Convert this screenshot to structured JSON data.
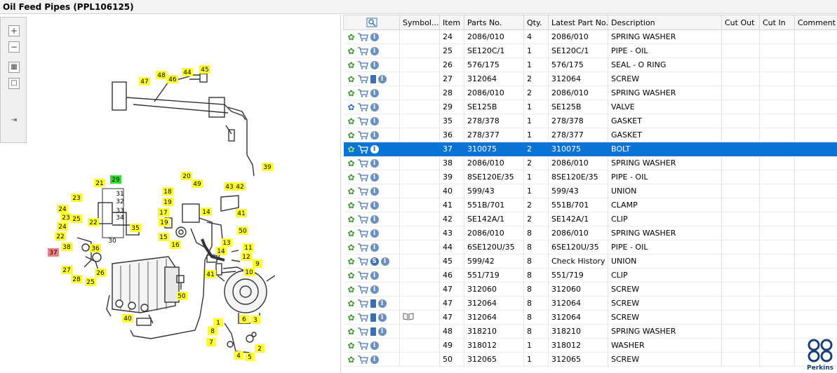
{
  "window": {
    "title": "Oil Feed Pipes (PPL106125)"
  },
  "toolbar": {
    "zoom_in": "+",
    "zoom_out": "−",
    "fit": "▦",
    "actual": "□",
    "export": "⇥"
  },
  "diagram": {
    "callouts": [
      {
        "label": "47",
        "style": "yellow"
      },
      {
        "label": "48",
        "style": "yellow"
      },
      {
        "label": "46",
        "style": "yellow"
      },
      {
        "label": "44",
        "style": "yellow"
      },
      {
        "label": "45",
        "style": "yellow"
      },
      {
        "label": "39",
        "style": "yellow"
      },
      {
        "label": "29",
        "style": "green"
      },
      {
        "label": "21",
        "style": "yellow"
      },
      {
        "label": "31",
        "style": "plain"
      },
      {
        "label": "32",
        "style": "plain"
      },
      {
        "label": "33",
        "style": "plain"
      },
      {
        "label": "34",
        "style": "plain"
      },
      {
        "label": "30",
        "style": "plain"
      },
      {
        "label": "35",
        "style": "yellow"
      },
      {
        "label": "23",
        "style": "yellow"
      },
      {
        "label": "24",
        "style": "yellow"
      },
      {
        "label": "25",
        "style": "yellow"
      },
      {
        "label": "23",
        "style": "yellow"
      },
      {
        "label": "24",
        "style": "yellow"
      },
      {
        "label": "22",
        "style": "yellow"
      },
      {
        "label": "22",
        "style": "yellow"
      },
      {
        "label": "38",
        "style": "yellow"
      },
      {
        "label": "36",
        "style": "yellow"
      },
      {
        "label": "37",
        "style": "red"
      },
      {
        "label": "27",
        "style": "yellow"
      },
      {
        "label": "28",
        "style": "yellow"
      },
      {
        "label": "25",
        "style": "yellow"
      },
      {
        "label": "26",
        "style": "yellow"
      },
      {
        "label": "20",
        "style": "yellow"
      },
      {
        "label": "49",
        "style": "yellow"
      },
      {
        "label": "18",
        "style": "yellow"
      },
      {
        "label": "19",
        "style": "yellow"
      },
      {
        "label": "17",
        "style": "yellow"
      },
      {
        "label": "19",
        "style": "yellow"
      },
      {
        "label": "14",
        "style": "yellow"
      },
      {
        "label": "15",
        "style": "yellow"
      },
      {
        "label": "16",
        "style": "yellow"
      },
      {
        "label": "43",
        "style": "yellow"
      },
      {
        "label": "42",
        "style": "yellow"
      },
      {
        "label": "41",
        "style": "yellow"
      },
      {
        "label": "50",
        "style": "yellow"
      },
      {
        "label": "13",
        "style": "yellow"
      },
      {
        "label": "14",
        "style": "yellow"
      },
      {
        "label": "11",
        "style": "yellow"
      },
      {
        "label": "12",
        "style": "yellow"
      },
      {
        "label": "9",
        "style": "yellow"
      },
      {
        "label": "10",
        "style": "yellow"
      },
      {
        "label": "41",
        "style": "yellow"
      },
      {
        "label": "50",
        "style": "yellow"
      },
      {
        "label": "40",
        "style": "yellow"
      },
      {
        "label": "1",
        "style": "yellow"
      },
      {
        "label": "6",
        "style": "yellow"
      },
      {
        "label": "3",
        "style": "yellow"
      },
      {
        "label": "8",
        "style": "yellow"
      },
      {
        "label": "7",
        "style": "yellow"
      },
      {
        "label": "2",
        "style": "yellow"
      },
      {
        "label": "4",
        "style": "yellow"
      },
      {
        "label": "5",
        "style": "yellow"
      }
    ]
  },
  "grid": {
    "columns": [
      "",
      "Symbol...",
      "Item",
      "Parts No.",
      "Qty.",
      "Latest Part No.",
      "Description",
      "Cut Out",
      "Cut In",
      "Comment"
    ],
    "rows": [
      {
        "icons": [
          "gear",
          "cart",
          "info"
        ],
        "symbol": "",
        "item": "24",
        "part": "2086/010",
        "qty": "4",
        "latest": "2086/010",
        "desc": "SPRING WASHER",
        "cutout": "",
        "cutin": "",
        "comment": ""
      },
      {
        "icons": [
          "gear",
          "cart",
          "info"
        ],
        "symbol": "",
        "item": "25",
        "part": "SE120C/1",
        "qty": "1",
        "latest": "SE120C/1",
        "desc": "PIPE - OIL",
        "cutout": "",
        "cutin": "",
        "comment": ""
      },
      {
        "icons": [
          "gear",
          "cart",
          "info"
        ],
        "symbol": "",
        "item": "26",
        "part": "576/175",
        "qty": "1",
        "latest": "576/175",
        "desc": "SEAL - O RING",
        "cutout": "",
        "cutin": "",
        "comment": ""
      },
      {
        "icons": [
          "gear",
          "cart",
          "book",
          "info"
        ],
        "symbol": "",
        "item": "27",
        "part": "312064",
        "qty": "2",
        "latest": "312064",
        "desc": "SCREW",
        "cutout": "",
        "cutin": "",
        "comment": ""
      },
      {
        "icons": [
          "gear",
          "cart",
          "info"
        ],
        "symbol": "",
        "item": "28",
        "part": "2086/010",
        "qty": "2",
        "latest": "2086/010",
        "desc": "SPRING WASHER",
        "cutout": "",
        "cutin": "",
        "comment": ""
      },
      {
        "icons": [
          "gears",
          "cart",
          "info"
        ],
        "symbol": "",
        "item": "29",
        "part": "SE125B",
        "qty": "1",
        "latest": "SE125B",
        "desc": "VALVE",
        "cutout": "",
        "cutin": "",
        "comment": ""
      },
      {
        "icons": [
          "gear",
          "cart",
          "info"
        ],
        "symbol": "",
        "item": "35",
        "part": "278/378",
        "qty": "1",
        "latest": "278/378",
        "desc": "GASKET",
        "cutout": "",
        "cutin": "",
        "comment": ""
      },
      {
        "icons": [
          "gear",
          "cart",
          "info"
        ],
        "symbol": "",
        "item": "36",
        "part": "278/377",
        "qty": "1",
        "latest": "278/377",
        "desc": "GASKET",
        "cutout": "",
        "cutin": "",
        "comment": ""
      },
      {
        "icons": [
          "gear",
          "cart",
          "info"
        ],
        "symbol": "",
        "item": "37",
        "part": "310075",
        "qty": "2",
        "latest": "310075",
        "desc": "BOLT",
        "cutout": "",
        "cutin": "",
        "comment": "",
        "selected": true
      },
      {
        "icons": [
          "gear",
          "cart",
          "info"
        ],
        "symbol": "",
        "item": "38",
        "part": "2086/010",
        "qty": "2",
        "latest": "2086/010",
        "desc": "SPRING WASHER",
        "cutout": "",
        "cutin": "",
        "comment": ""
      },
      {
        "icons": [
          "gear",
          "cart",
          "info"
        ],
        "symbol": "",
        "item": "39",
        "part": "8SE120E/35",
        "qty": "1",
        "latest": "8SE120E/35",
        "desc": "PIPE - OIL",
        "cutout": "",
        "cutin": "",
        "comment": ""
      },
      {
        "icons": [
          "gear",
          "cart",
          "info"
        ],
        "symbol": "",
        "item": "40",
        "part": "599/43",
        "qty": "1",
        "latest": "599/43",
        "desc": "UNION",
        "cutout": "",
        "cutin": "",
        "comment": ""
      },
      {
        "icons": [
          "gear",
          "cart",
          "info"
        ],
        "symbol": "",
        "item": "41",
        "part": "551B/701",
        "qty": "2",
        "latest": "551B/701",
        "desc": "CLAMP",
        "cutout": "",
        "cutin": "",
        "comment": ""
      },
      {
        "icons": [
          "gear",
          "cart",
          "info"
        ],
        "symbol": "",
        "item": "42",
        "part": "SE142A/1",
        "qty": "2",
        "latest": "SE142A/1",
        "desc": "CLIP",
        "cutout": "",
        "cutin": "",
        "comment": ""
      },
      {
        "icons": [
          "gear",
          "cart",
          "info"
        ],
        "symbol": "",
        "item": "43",
        "part": "2086/010",
        "qty": "8",
        "latest": "2086/010",
        "desc": "SPRING WASHER",
        "cutout": "",
        "cutin": "",
        "comment": ""
      },
      {
        "icons": [
          "gear",
          "cart",
          "info"
        ],
        "symbol": "",
        "item": "44",
        "part": "6SE120U/35",
        "qty": "8",
        "latest": "6SE120U/35",
        "desc": "PIPE - OIL",
        "cutout": "",
        "cutin": "",
        "comment": ""
      },
      {
        "icons": [
          "gear",
          "cart",
          "s",
          "info"
        ],
        "symbol": "",
        "item": "45",
        "part": "599/42",
        "qty": "8",
        "latest": "Check History",
        "desc": "UNION",
        "cutout": "",
        "cutin": "",
        "comment": ""
      },
      {
        "icons": [
          "gear",
          "cart",
          "info"
        ],
        "symbol": "",
        "item": "46",
        "part": "551/719",
        "qty": "8",
        "latest": "551/719",
        "desc": "CLIP",
        "cutout": "",
        "cutin": "",
        "comment": ""
      },
      {
        "icons": [
          "gear",
          "cart",
          "info"
        ],
        "symbol": "",
        "item": "47",
        "part": "312060",
        "qty": "8",
        "latest": "312060",
        "desc": "SCREW",
        "cutout": "",
        "cutin": "",
        "comment": ""
      },
      {
        "icons": [
          "gear",
          "cart",
          "book",
          "info"
        ],
        "symbol": "",
        "item": "47",
        "part": "312064",
        "qty": "8",
        "latest": "312064",
        "desc": "SCREW",
        "cutout": "",
        "cutin": "",
        "comment": ""
      },
      {
        "icons": [
          "gear",
          "cart",
          "book",
          "info"
        ],
        "symbol": "note",
        "item": "47",
        "part": "312064",
        "qty": "8",
        "latest": "312064",
        "desc": "SCREW",
        "cutout": "",
        "cutin": "",
        "comment": ""
      },
      {
        "icons": [
          "gear",
          "cart",
          "book",
          "info"
        ],
        "symbol": "",
        "item": "48",
        "part": "318210",
        "qty": "8",
        "latest": "318210",
        "desc": "SPRING WASHER",
        "cutout": "",
        "cutin": "",
        "comment": ""
      },
      {
        "icons": [
          "gear",
          "cart",
          "info"
        ],
        "symbol": "",
        "item": "49",
        "part": "318012",
        "qty": "1",
        "latest": "318012",
        "desc": "WASHER",
        "cutout": "",
        "cutin": "",
        "comment": ""
      },
      {
        "icons": [
          "gear",
          "cart",
          "info"
        ],
        "symbol": "",
        "item": "50",
        "part": "312065",
        "qty": "1",
        "latest": "312065",
        "desc": "SCREW",
        "cutout": "",
        "cutin": "",
        "comment": ""
      }
    ]
  },
  "brand": {
    "name": "Perkins",
    "color": "#1a3e7a"
  },
  "colors": {
    "selection": "#0a74d6",
    "callout_yellow": "#ffff33",
    "callout_green": "#33dd33",
    "callout_red": "#f08080"
  }
}
